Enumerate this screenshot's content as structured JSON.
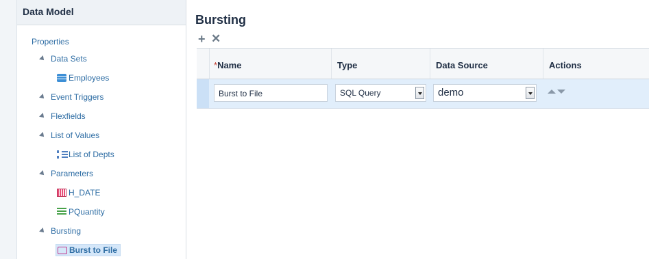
{
  "sidebar": {
    "header": "Data Model",
    "properties": "Properties",
    "data_sets": "Data Sets",
    "employees": "Employees",
    "event_triggers": "Event Triggers",
    "flexfields": "Flexfields",
    "list_of_values": "List of Values",
    "list_of_depts": "List of Depts",
    "parameters": "Parameters",
    "h_date": "H_DATE",
    "pquantity": "PQuantity",
    "bursting": "Bursting",
    "burst_to_file": "Burst to File"
  },
  "main": {
    "title": "Bursting",
    "add_icon": "+",
    "delete_icon": "✕",
    "columns": {
      "required_marker": "*",
      "name": "Name",
      "type": "Type",
      "data_source": "Data Source",
      "actions": "Actions"
    },
    "row": {
      "name": "Burst to File",
      "type": "SQL Query",
      "data_source": "demo"
    }
  }
}
